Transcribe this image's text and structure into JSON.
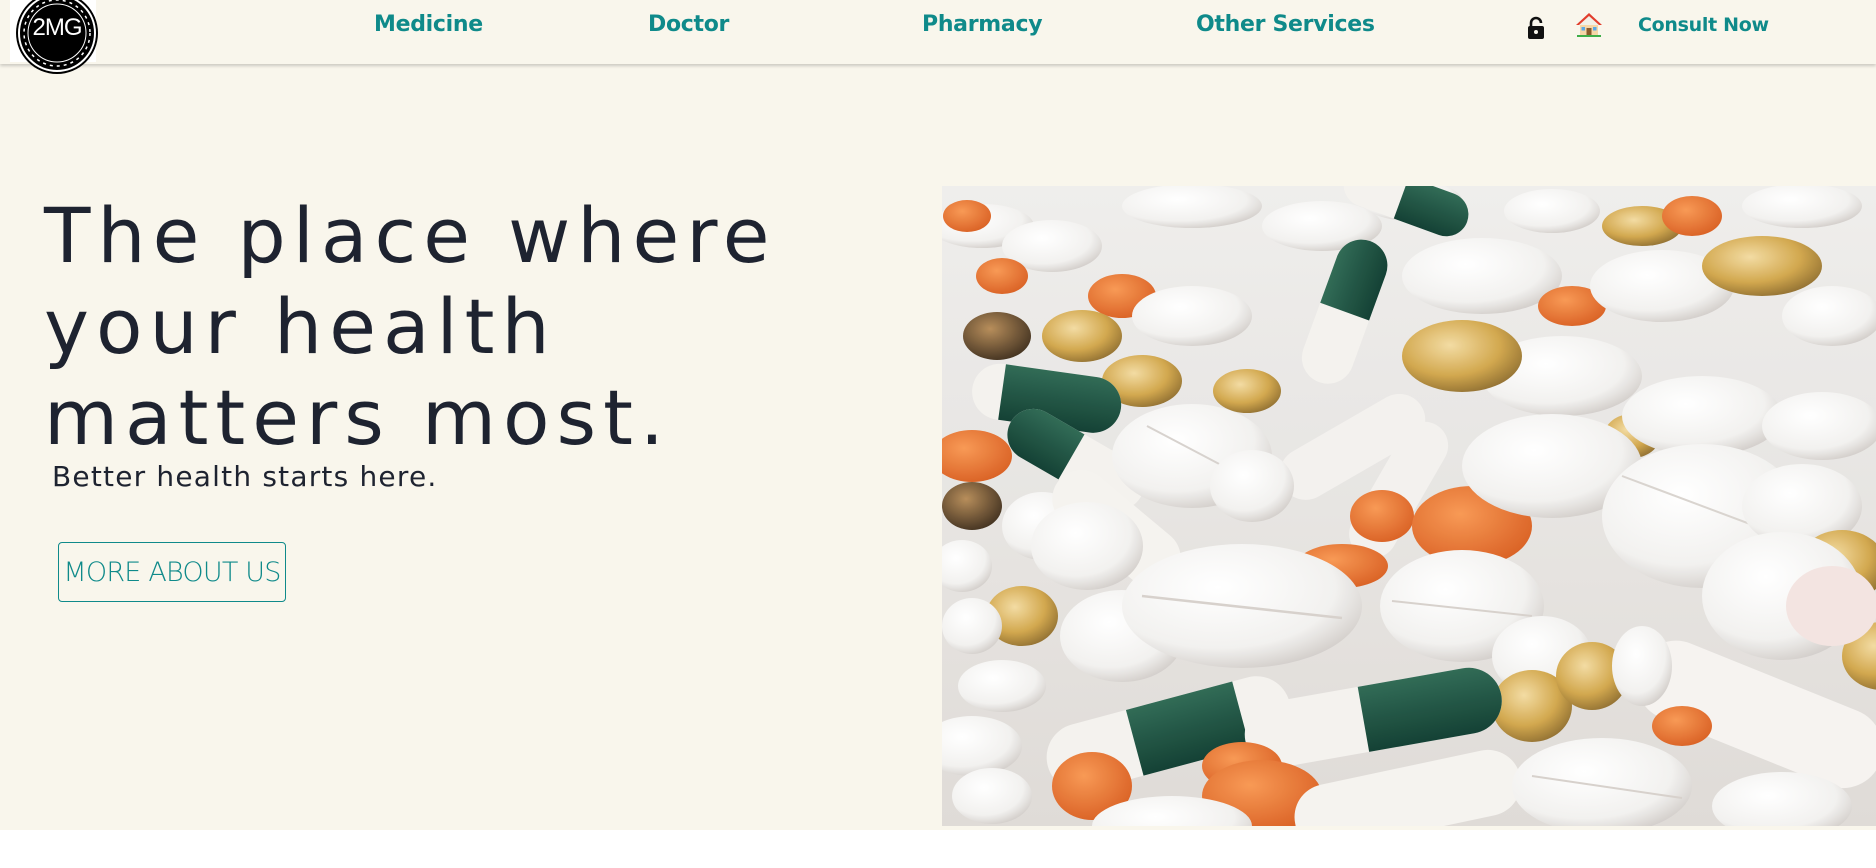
{
  "header": {
    "logo_text": "2MG",
    "nav": {
      "medicine": "Medicine",
      "doctor": "Doctor",
      "pharmacy": "Pharmacy",
      "other_services": "Other Services"
    },
    "icons": [
      "lock-icon",
      "home-icon"
    ],
    "consult_label": "Consult Now"
  },
  "hero": {
    "heading": "The place where your health matters most.",
    "subheading": "Better health starts here.",
    "button_label": "MORE ABOUT US",
    "image_subject": "pills-photo"
  },
  "colors": {
    "background": "#f9f6ec",
    "accent": "#0f8a8a",
    "heading_text": "#1e2330"
  }
}
